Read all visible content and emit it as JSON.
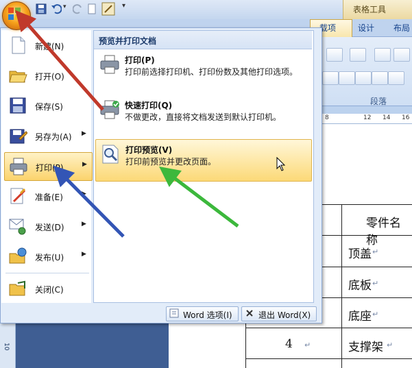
{
  "ribbon": {
    "contextual_group": "表格工具",
    "tabs": [
      "载项",
      "设计",
      "布局"
    ],
    "group_label": "段落",
    "ruler_marks": [
      "8",
      "12",
      "14",
      "16"
    ]
  },
  "office_menu": {
    "items": [
      {
        "label": "新建(N)",
        "icon": "new-document-icon",
        "has_submenu": false
      },
      {
        "label": "打开(O)",
        "icon": "open-folder-icon",
        "has_submenu": false
      },
      {
        "label": "保存(S)",
        "icon": "save-disk-icon",
        "has_submenu": false
      },
      {
        "label": "另存为(A)",
        "icon": "save-as-icon",
        "has_submenu": true
      },
      {
        "label": "打印(P)",
        "icon": "printer-icon",
        "has_submenu": true,
        "highlighted": true
      },
      {
        "label": "准备(E)",
        "icon": "prepare-icon",
        "has_submenu": true
      },
      {
        "label": "发送(D)",
        "icon": "send-icon",
        "has_submenu": true
      },
      {
        "label": "发布(U)",
        "icon": "publish-icon",
        "has_submenu": true
      },
      {
        "label": "关闭(C)",
        "icon": "close-folder-icon",
        "has_submenu": false
      }
    ],
    "submenu": {
      "header": "预览并打印文档",
      "options": [
        {
          "title": "打印(P)",
          "desc": "打印前选择打印机、打印份数及其他打印选项。",
          "icon": "printer-icon"
        },
        {
          "title": "快速打印(Q)",
          "desc": "不做更改，直接将文档发送到默认打印机。",
          "icon": "quick-print-icon"
        },
        {
          "title": "打印预览(V)",
          "desc": "打印前预览并更改页面。",
          "icon": "print-preview-icon",
          "highlighted": true
        }
      ]
    },
    "footer": {
      "word_options": "Word 选项(I)",
      "exit_word": "退出 Word(X)"
    }
  },
  "document": {
    "table_cells": [
      "零件名称",
      "顶盖",
      "底板",
      "底座",
      "4",
      "支撑架"
    ],
    "vertical_ruler": "10"
  },
  "colors": {
    "red_arrow": "#c0392b",
    "blue_arrow": "#3355b5",
    "green_arrow": "#3cb83c",
    "highlight": "#fbd36c"
  }
}
